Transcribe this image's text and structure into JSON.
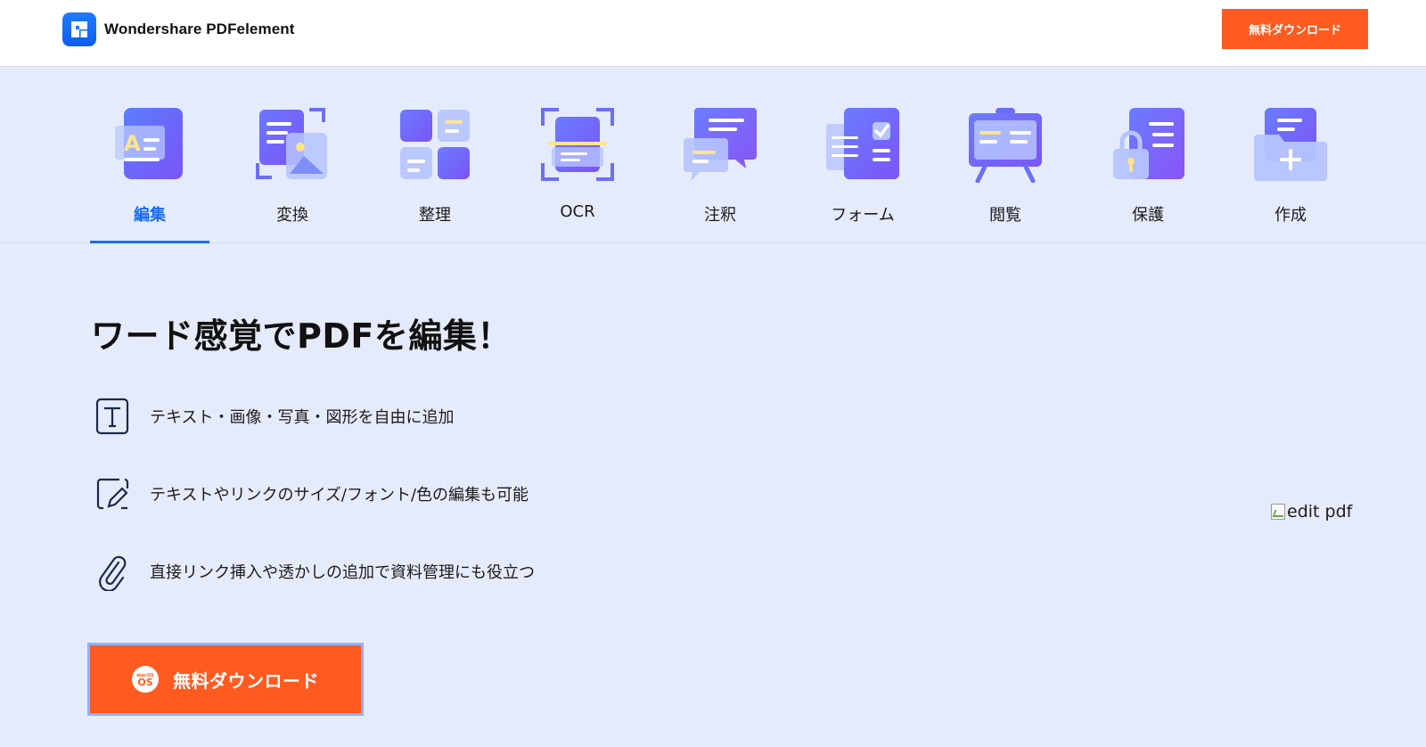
{
  "header": {
    "brand_name": "Wondershare PDFelement",
    "download_label": "無料ダウンロード"
  },
  "tabs": [
    {
      "label": "編集",
      "icon": "edit-icon",
      "active": true
    },
    {
      "label": "変換",
      "icon": "convert-icon",
      "active": false
    },
    {
      "label": "整理",
      "icon": "organize-icon",
      "active": false
    },
    {
      "label": "OCR",
      "icon": "ocr-icon",
      "active": false
    },
    {
      "label": "注釈",
      "icon": "annotate-icon",
      "active": false
    },
    {
      "label": "フォーム",
      "icon": "form-icon",
      "active": false
    },
    {
      "label": "閲覧",
      "icon": "read-icon",
      "active": false
    },
    {
      "label": "保護",
      "icon": "protect-icon",
      "active": false
    },
    {
      "label": "作成",
      "icon": "create-icon",
      "active": false
    }
  ],
  "main": {
    "headline": "ワード感覚でPDFを編集！",
    "features": [
      {
        "icon": "text-tool-icon",
        "text": "テキスト・画像・写真・図形を自由に追加"
      },
      {
        "icon": "pencil-edit-icon",
        "text": "テキストやリンクのサイズ/フォント/色の編集も可能"
      },
      {
        "icon": "paperclip-icon",
        "text": "直接リンク挿入や透かしの追加で資料管理にも役立つ"
      }
    ],
    "cta_os_top": "macOS",
    "cta_os_main": "OS",
    "cta_label": "無料ダウンロード",
    "image_alt": "edit pdf"
  },
  "colors": {
    "accent_blue": "#1a6cf0",
    "cta_orange": "#ff5a1f",
    "page_bg": "#e5ebfb"
  }
}
